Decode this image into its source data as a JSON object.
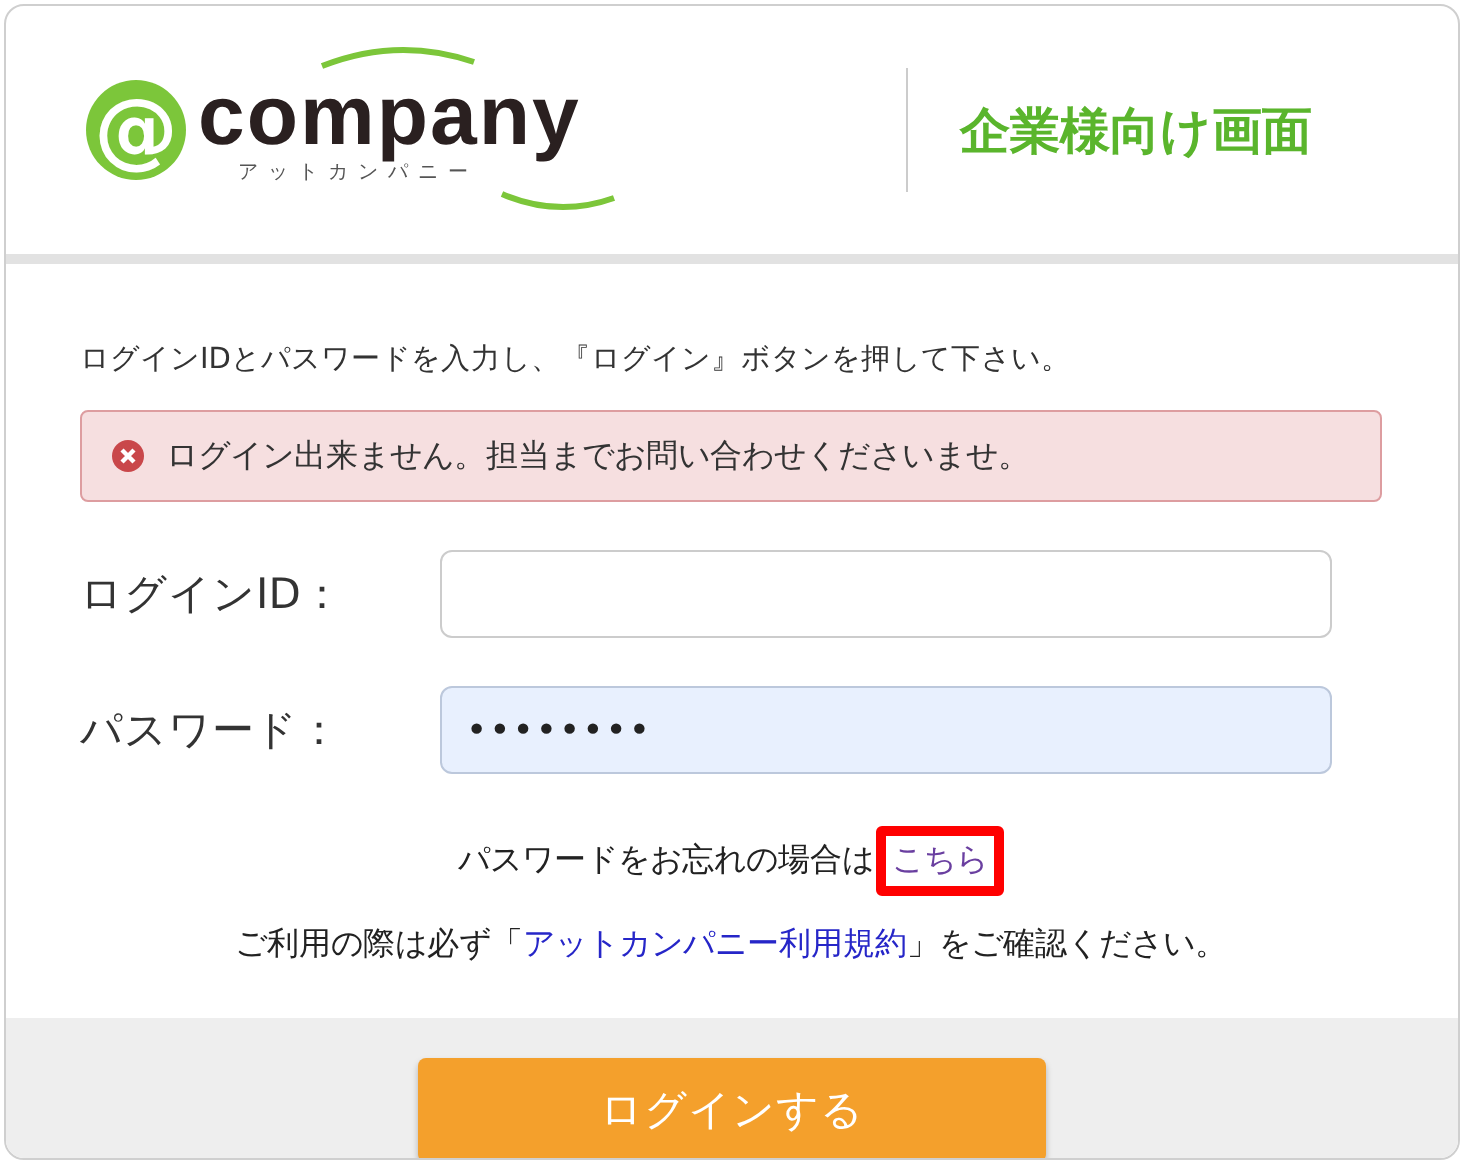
{
  "header": {
    "logo": {
      "mark": "@",
      "name": "company",
      "reading": "アットカンパニー"
    },
    "title": "企業様向け画面"
  },
  "instruction": "ログインIDとパスワードを入力し、『ログイン』ボタンを押して下さい。",
  "error": {
    "message": "ログイン出来ません。担当までお問い合わせくださいませ。"
  },
  "fields": [
    {
      "label": "ログインID：",
      "kind": "text",
      "focused": false
    },
    {
      "label": "パスワード：",
      "kind": "password",
      "value": "••••••••",
      "focused": true
    }
  ],
  "forgot": {
    "text": "パスワードをお忘れの場合は",
    "link": "こちら",
    "highlighted": true
  },
  "terms": {
    "before": "ご利用の際は必ず「",
    "link": "アットカンパニー利用規約",
    "after": "」をご確認ください。"
  },
  "submit": {
    "label": "ログインする"
  }
}
